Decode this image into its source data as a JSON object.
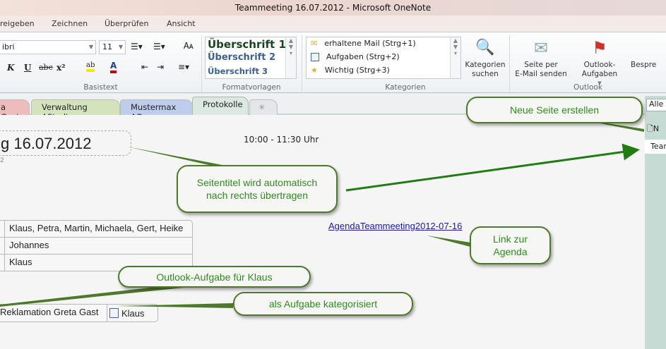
{
  "window": {
    "title": "Teammeeting 16.07.2012  -  Microsoft OneNote"
  },
  "menu": [
    "reigeben",
    "Zeichnen",
    "Überprüfen",
    "Ansicht"
  ],
  "ribbon": {
    "basistext": {
      "font": "ibri",
      "size": "11",
      "label": "Basistext",
      "bold": "K",
      "underline": "U",
      "strike": "abc",
      "super": "x²",
      "highlight": "ab",
      "fontcolor": "A"
    },
    "formatvorlagen": {
      "styles": [
        "Überschrift 1",
        "Überschrift 2",
        "Überschrift 3"
      ],
      "label": "Formatvorlagen"
    },
    "kategorien": {
      "items": [
        "erhaltene Mail (Strg+1)",
        "Aufgaben (Strg+2)",
        "Wichtig (Strg+3)"
      ],
      "search_l1": "Kategorien",
      "search_l2": "suchen",
      "label": "Kategorien"
    },
    "outlook": {
      "email_l1": "Seite per",
      "email_l2": "E-Mail senden",
      "tasks": "Outlook-Aufgaben",
      "meeting": "Bespre",
      "label": "Outlook"
    }
  },
  "section_tabs": [
    "a Gast",
    "Verwaltung AStadt",
    "Mustermax AG",
    "Protokolle"
  ],
  "page": {
    "title": "g 16.07.2012",
    "date_fragment": "2",
    "time": "10:00 - 11:30 Uhr",
    "link": "AgendaTeammeeting2012-07-16",
    "table": [
      "Klaus, Petra, Martin, Michaela, Gert, Heike",
      "Johannes",
      "Klaus"
    ],
    "task_row": {
      "text": "Reklamation Greta Gast",
      "assignee": "Klaus"
    }
  },
  "right_pane": {
    "search": "Alle",
    "new_page": "N",
    "page_item": "Tear"
  },
  "callouts": {
    "new_page": "Neue Seite erstellen",
    "title": "Seitentitel wird automatisch nach rechts übertragen",
    "link": "Link zur Agenda",
    "outlook_task": "Outlook-Aufgabe für Klaus",
    "category": "als Aufgabe kategorisiert"
  },
  "colors": {
    "callout_text": "#2f8a1f",
    "callout_border": "#4d7a2a",
    "link": "#1a1aa6"
  }
}
